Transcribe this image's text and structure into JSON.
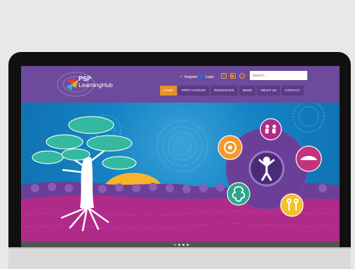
{
  "site": {
    "logo_line1": "PSP",
    "logo_line2": "LearningHub",
    "utility": {
      "register": "Register",
      "login": "Login"
    },
    "search_placeholder": "Search...",
    "nav": [
      "HOME",
      "FIRST CHOICES",
      "RESOURCES",
      "NEWS",
      "ABOUT US",
      "CONTACT"
    ],
    "active_nav_index": 0
  },
  "hero": {
    "slides": 3,
    "active_slide": 1
  },
  "colors": {
    "header_purple": "#6d4a9b",
    "nav_active": "#e8912a",
    "accent_orange": "#f5a623",
    "hero_blue": "#1583c4",
    "ground_magenta": "#b02a8a"
  },
  "icons": {
    "register": "check-icon",
    "login": "user-icon",
    "social": [
      "facebook-icon",
      "youtube-icon",
      "instagram-icon"
    ]
  }
}
